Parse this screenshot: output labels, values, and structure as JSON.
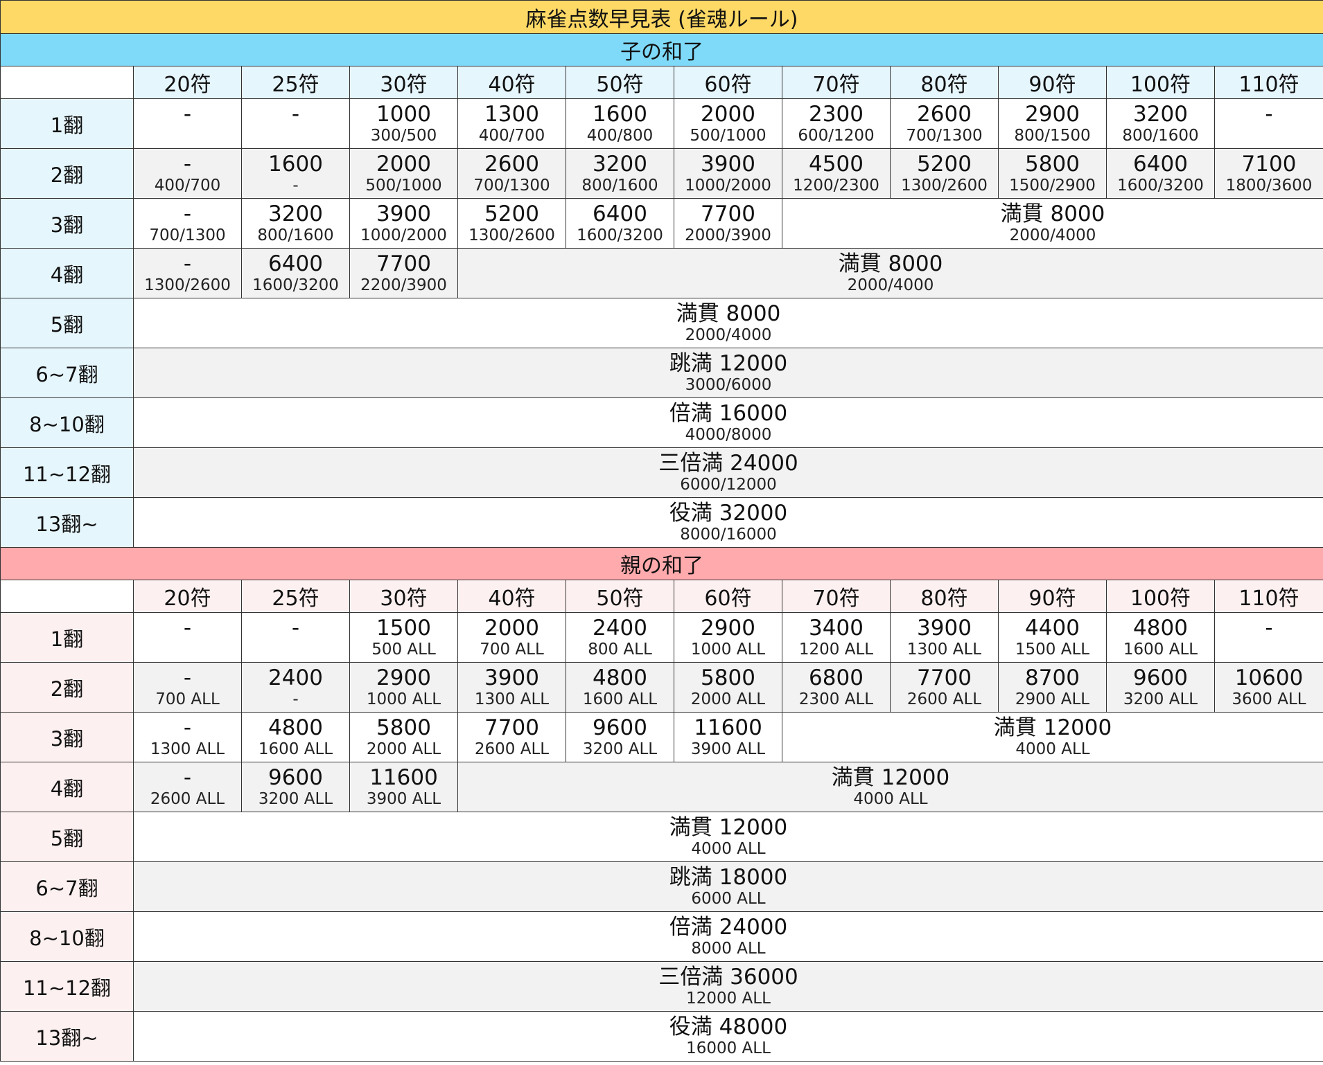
{
  "title": "麻雀点数早見表 (雀魂ルール)",
  "sections": [
    {
      "key": "ko",
      "heading": "子の和了",
      "fu_headers": [
        "20符",
        "25符",
        "30符",
        "40符",
        "50符",
        "60符",
        "70符",
        "80符",
        "90符",
        "100符",
        "110符"
      ],
      "rows": [
        {
          "han": "1翻",
          "cells": [
            {
              "points": "-",
              "pay": ""
            },
            {
              "points": "-",
              "pay": ""
            },
            {
              "points": "1000",
              "pay": "300/500"
            },
            {
              "points": "1300",
              "pay": "400/700"
            },
            {
              "points": "1600",
              "pay": "400/800"
            },
            {
              "points": "2000",
              "pay": "500/1000"
            },
            {
              "points": "2300",
              "pay": "600/1200"
            },
            {
              "points": "2600",
              "pay": "700/1300"
            },
            {
              "points": "2900",
              "pay": "800/1500"
            },
            {
              "points": "3200",
              "pay": "800/1600"
            },
            {
              "points": "-",
              "pay": ""
            }
          ]
        },
        {
          "han": "2翻",
          "cells": [
            {
              "points": "-",
              "pay": "400/700"
            },
            {
              "points": "1600",
              "pay": "-"
            },
            {
              "points": "2000",
              "pay": "500/1000"
            },
            {
              "points": "2600",
              "pay": "700/1300"
            },
            {
              "points": "3200",
              "pay": "800/1600"
            },
            {
              "points": "3900",
              "pay": "1000/2000"
            },
            {
              "points": "4500",
              "pay": "1200/2300"
            },
            {
              "points": "5200",
              "pay": "1300/2600"
            },
            {
              "points": "5800",
              "pay": "1500/2900"
            },
            {
              "points": "6400",
              "pay": "1600/3200"
            },
            {
              "points": "7100",
              "pay": "1800/3600"
            }
          ]
        },
        {
          "han": "3翻",
          "cells": [
            {
              "points": "-",
              "pay": "700/1300"
            },
            {
              "points": "3200",
              "pay": "800/1600"
            },
            {
              "points": "3900",
              "pay": "1000/2000"
            },
            {
              "points": "5200",
              "pay": "1300/2600"
            },
            {
              "points": "6400",
              "pay": "1600/3200"
            },
            {
              "points": "7700",
              "pay": "2000/3900"
            },
            {
              "points": "満貫 8000",
              "pay": "2000/4000",
              "span": 5
            }
          ]
        },
        {
          "han": "4翻",
          "cells": [
            {
              "points": "-",
              "pay": "1300/2600"
            },
            {
              "points": "6400",
              "pay": "1600/3200"
            },
            {
              "points": "7700",
              "pay": "2200/3900"
            },
            {
              "points": "満貫 8000",
              "pay": "2000/4000",
              "span": 8
            }
          ]
        },
        {
          "han": "5翻",
          "cells": [
            {
              "points": "満貫 8000",
              "pay": "2000/4000",
              "span": 11
            }
          ]
        },
        {
          "han": "6~7翻",
          "cells": [
            {
              "points": "跳満 12000",
              "pay": "3000/6000",
              "span": 11
            }
          ]
        },
        {
          "han": "8~10翻",
          "cells": [
            {
              "points": "倍満 16000",
              "pay": "4000/8000",
              "span": 11
            }
          ]
        },
        {
          "han": "11~12翻",
          "cells": [
            {
              "points": "三倍満 24000",
              "pay": "6000/12000",
              "span": 11
            }
          ]
        },
        {
          "han": "13翻~",
          "cells": [
            {
              "points": "役満 32000",
              "pay": "8000/16000",
              "span": 11
            }
          ]
        }
      ]
    },
    {
      "key": "oya",
      "heading": "親の和了",
      "fu_headers": [
        "20符",
        "25符",
        "30符",
        "40符",
        "50符",
        "60符",
        "70符",
        "80符",
        "90符",
        "100符",
        "110符"
      ],
      "rows": [
        {
          "han": "1翻",
          "cells": [
            {
              "points": "-",
              "pay": ""
            },
            {
              "points": "-",
              "pay": ""
            },
            {
              "points": "1500",
              "pay": "500 ALL"
            },
            {
              "points": "2000",
              "pay": "700 ALL"
            },
            {
              "points": "2400",
              "pay": "800 ALL"
            },
            {
              "points": "2900",
              "pay": "1000 ALL"
            },
            {
              "points": "3400",
              "pay": "1200 ALL"
            },
            {
              "points": "3900",
              "pay": "1300 ALL"
            },
            {
              "points": "4400",
              "pay": "1500 ALL"
            },
            {
              "points": "4800",
              "pay": "1600 ALL"
            },
            {
              "points": "-",
              "pay": ""
            }
          ]
        },
        {
          "han": "2翻",
          "cells": [
            {
              "points": "-",
              "pay": "700 ALL"
            },
            {
              "points": "2400",
              "pay": "-"
            },
            {
              "points": "2900",
              "pay": "1000 ALL"
            },
            {
              "points": "3900",
              "pay": "1300 ALL"
            },
            {
              "points": "4800",
              "pay": "1600 ALL"
            },
            {
              "points": "5800",
              "pay": "2000 ALL"
            },
            {
              "points": "6800",
              "pay": "2300 ALL"
            },
            {
              "points": "7700",
              "pay": "2600 ALL"
            },
            {
              "points": "8700",
              "pay": "2900 ALL"
            },
            {
              "points": "9600",
              "pay": "3200 ALL"
            },
            {
              "points": "10600",
              "pay": "3600 ALL"
            }
          ]
        },
        {
          "han": "3翻",
          "cells": [
            {
              "points": "-",
              "pay": "1300 ALL"
            },
            {
              "points": "4800",
              "pay": "1600 ALL"
            },
            {
              "points": "5800",
              "pay": "2000 ALL"
            },
            {
              "points": "7700",
              "pay": "2600 ALL"
            },
            {
              "points": "9600",
              "pay": "3200 ALL"
            },
            {
              "points": "11600",
              "pay": "3900 ALL"
            },
            {
              "points": "満貫 12000",
              "pay": "4000 ALL",
              "span": 5
            }
          ]
        },
        {
          "han": "4翻",
          "cells": [
            {
              "points": "-",
              "pay": "2600 ALL"
            },
            {
              "points": "9600",
              "pay": "3200 ALL"
            },
            {
              "points": "11600",
              "pay": "3900 ALL"
            },
            {
              "points": "満貫 12000",
              "pay": "4000 ALL",
              "span": 8
            }
          ]
        },
        {
          "han": "5翻",
          "cells": [
            {
              "points": "満貫 12000",
              "pay": "4000 ALL",
              "span": 11
            }
          ]
        },
        {
          "han": "6~7翻",
          "cells": [
            {
              "points": "跳満 18000",
              "pay": "6000 ALL",
              "span": 11
            }
          ]
        },
        {
          "han": "8~10翻",
          "cells": [
            {
              "points": "倍満 24000",
              "pay": "8000 ALL",
              "span": 11
            }
          ]
        },
        {
          "han": "11~12翻",
          "cells": [
            {
              "points": "三倍満 36000",
              "pay": "12000 ALL",
              "span": 11
            }
          ]
        },
        {
          "han": "13翻~",
          "cells": [
            {
              "points": "役満 48000",
              "pay": "16000 ALL",
              "span": 11
            }
          ]
        }
      ]
    }
  ]
}
